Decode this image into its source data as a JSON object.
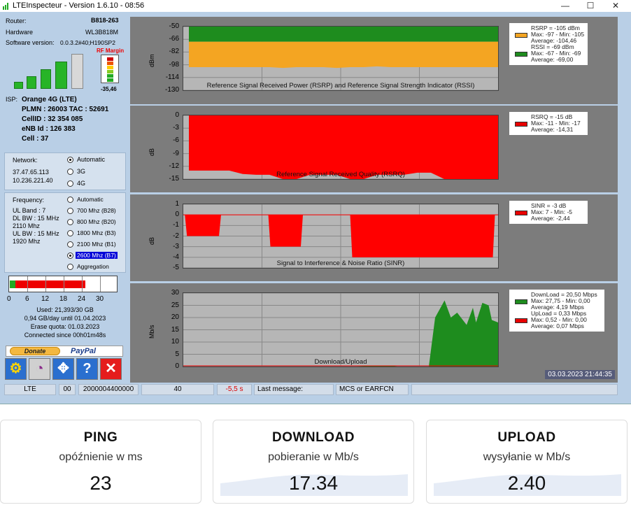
{
  "window": {
    "title": "LTEInspecteur - Version 1.6.10 - 08:56",
    "min": "—",
    "max": "☐",
    "close": "✕"
  },
  "sidebar": {
    "router_label": "Router:",
    "router_value": "B818-263",
    "hardware_label": "Hardware",
    "hardware_value": "WL3B818M",
    "software_label": "Software version:",
    "software_value": "0.0.3.2#40;H190SP2",
    "rf_margin_label": "RF Margin",
    "rf_margin_value": "-35,46",
    "isp_label": "ISP:",
    "isp_value": "Orange 4G (LTE)",
    "plmn": "PLMN : 26003 TAC : 52691",
    "cellid": "CellID : 32 354 085",
    "enb": "eNB Id : 126 383",
    "cell": "Cell : 37",
    "signal_bars": [
      1,
      2,
      3,
      4,
      5
    ],
    "signal_active": 4,
    "network": {
      "label": "Network:",
      "ip1": "37.47.65.113",
      "ip2": "10.236.221.40",
      "options": [
        "Automatic",
        "3G",
        "4G"
      ],
      "selected": 0
    },
    "frequency": {
      "label": "Frequency:",
      "info": [
        "UL Band : 7",
        "DL BW : 15 MHz",
        "2110 Mhz",
        "UL BW : 15 MHz",
        "1920 Mhz"
      ],
      "options": [
        "Automatic",
        "700 Mhz (B28)",
        "800 Mhz (B20)",
        "1800 Mhz (B3)",
        "2100 Mhz (B1)",
        "2600 Mhz (B7)",
        "Aggregation"
      ],
      "selected": 5
    },
    "quota": {
      "ticks": [
        "0",
        "6",
        "12",
        "18",
        "24",
        "30"
      ],
      "used_fraction": 0.7,
      "green_fraction": 0.05,
      "used": "Used: 21,393/30 GB",
      "per_day": "0,94 GB/day until 01.04.2023",
      "erase": "Erase quota: 01.03.2023",
      "connected": "Connected since 00h01m48s"
    },
    "donate_label": "Donate",
    "paypal_label": "PayPal",
    "tools": [
      {
        "icon": "settings-icon",
        "label": "⚙"
      },
      {
        "icon": "gauge-icon",
        "label": "◔"
      },
      {
        "icon": "fullscreen-icon",
        "label": "✥"
      },
      {
        "icon": "help-icon",
        "label": "?"
      },
      {
        "icon": "close-icon",
        "label": "✕"
      }
    ]
  },
  "charts": [
    {
      "id": "rsrp",
      "title": "Reference Signal Received Power (RSRP) and Reference Signal Strength Indicator (RSSI)",
      "ylabel": "dBm",
      "yticks": [
        "-50",
        "-66",
        "-82",
        "-98",
        "-114",
        "-130"
      ],
      "ymin": -130,
      "ymax": -50,
      "legend": [
        {
          "head": "RSRP = -105 dBm",
          "lines": [
            "Max: -97 - Min: -105",
            "Average: -104,46"
          ],
          "color": "#f4a522"
        },
        {
          "head": "RSSI = -69 dBm",
          "lines": [
            "Max: -67 - Min: -69",
            "Average: -69,00"
          ],
          "color": "#1e8c1e"
        }
      ]
    },
    {
      "id": "rsrq",
      "title": "Reference Signal Received Quality (RSRQ)",
      "ylabel": "dB",
      "yticks": [
        "0",
        "-3",
        "-6",
        "-9",
        "-12",
        "-15"
      ],
      "ymin": -15,
      "ymax": 0,
      "legend": [
        {
          "head": "RSRQ = -15 dB",
          "lines": [
            "Max: -11 - Min: -17",
            "Average: -14,31"
          ],
          "color": "#e80000"
        }
      ]
    },
    {
      "id": "sinr",
      "title": "Signal to Interference & Noise Ratio (SINR)",
      "ylabel": "dB",
      "yticks": [
        "1",
        "0",
        "-1",
        "-2",
        "-3",
        "-4",
        "-5"
      ],
      "ymin": -5,
      "ymax": 1,
      "legend": [
        {
          "head": "SINR = -3 dB",
          "lines": [
            "Max: 7 - Min: -5",
            "Average: -2,44"
          ],
          "color": "#e80000"
        }
      ]
    },
    {
      "id": "dl",
      "title": "Download/Upload",
      "ylabel": "Mb/s",
      "yticks": [
        "30",
        "25",
        "20",
        "15",
        "10",
        "5",
        "0"
      ],
      "ymin": 0,
      "ymax": 30,
      "legend": [
        {
          "head": "DownLoad = 20,50 Mbps",
          "lines": [
            "Max: 27,75 - Min: 0,00",
            "Average: 4,19 Mbps"
          ],
          "color": "#1e8c1e"
        },
        {
          "head": "UpLoad = 0,33 Mbps",
          "lines": [
            "Max: 0,52 - Min: 0,00",
            "Average: 0,07 Mbps"
          ],
          "color": "#e80000"
        }
      ],
      "timestamp": "03.03.2023 21:44:35"
    }
  ],
  "statusbar": {
    "mode": "LTE",
    "code": "00",
    "id": "2000004400000",
    "n40": "40",
    "timer": "-5,5 s",
    "lastmsg_label": "Last message:",
    "lastmsg": "MCS or EARFCN"
  },
  "speedtest": [
    {
      "title": "PING",
      "subtitle": "opóźnienie w ms",
      "value": "23"
    },
    {
      "title": "DOWNLOAD",
      "subtitle": "pobieranie w Mb/s",
      "value": "17.34"
    },
    {
      "title": "UPLOAD",
      "subtitle": "wysyłanie w Mb/s",
      "value": "2.40"
    }
  ]
}
